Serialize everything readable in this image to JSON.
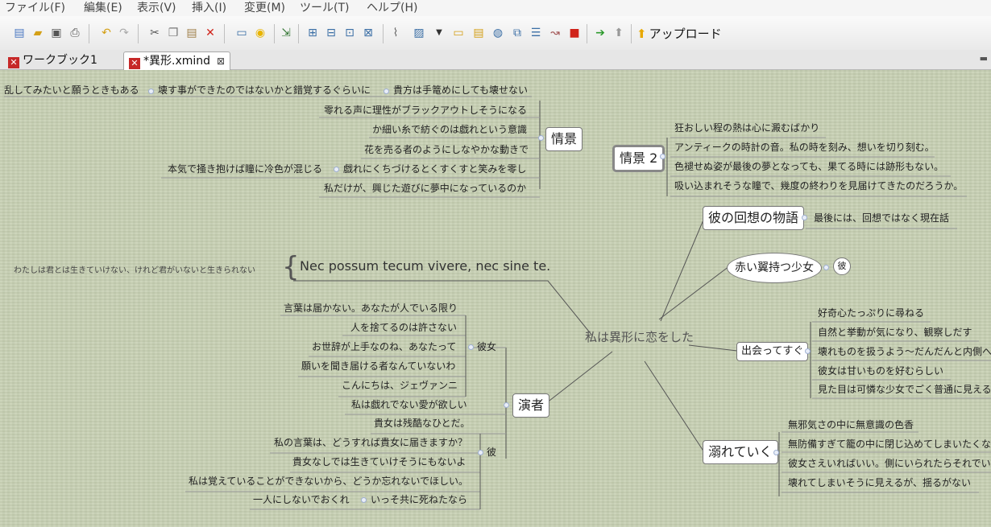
{
  "menu": [
    "ファイル(F)",
    "編集(E)",
    "表示(V)",
    "挿入(I)",
    "変更(M)",
    "ツール(T)",
    "ヘルプ(H)"
  ],
  "toolbar": {
    "upload_label": "アップロード"
  },
  "tabs": [
    {
      "label": "ワークブック1"
    },
    {
      "label": "*異形.xmind"
    }
  ],
  "mindmap": {
    "central": "私は異形に恋をした",
    "left_top_row": {
      "a": "乱してみたいと願うときもある",
      "b": "壊す事ができたのではないかと錯覚するぐらいに",
      "c": "貴方は手篭めにしても壊せない"
    },
    "scene": {
      "label": "情景",
      "items": [
        "零れる声に理性がブラックアウトしそうになる",
        "か細い糸で紡ぐのは戯れという意識",
        "花を売る者のようにしなやかな動きで",
        "戯れにくちづけるとくすくすと笑みを零し",
        "私だけが、興じた遊びに夢中になっているのか"
      ],
      "extra": "本気で掻き抱けば瞳に冷色が混じる"
    },
    "scene2": {
      "label": "情景 2",
      "items": [
        "狂おしい程の熱は心に澱むばかり",
        "アンティークの時計の音。私の時を刻み、想いを切り刻む。",
        "色褪せぬ姿が最後の夢となっても、果てる時には跡形もない。",
        "吸い込まれそうな瞳で、幾度の終わりを見届けてきたのだろうか。"
      ]
    },
    "latin": {
      "label": "Nec possum tecum vivere, nec sine te.",
      "note": "わたしは君とは生きていけない、けれど君がいないと生きられない"
    },
    "story": {
      "label": "彼の回想の物語",
      "items": [
        "最後には、回想ではなく現在話"
      ]
    },
    "girl": {
      "label": "赤い翼持つ少女",
      "child": "彼"
    },
    "meet": {
      "label": "出会ってすぐ",
      "items": [
        "好奇心たっぷりに尋ねる",
        "自然と挙動が気になり、観察しだす",
        "壊れものを扱うよう～だんだんと内側へ",
        "彼女は甘いものを好むらしい",
        "見た目は可憐な少女でごく普通に見える"
      ]
    },
    "drown": {
      "label": "溺れていく",
      "items": [
        "無邪気さの中に無意識の色香",
        "無防備すぎて籠の中に閉じ込めてしまいたくなる",
        "彼女さえいればいい。側にいられたらそれでいい",
        "壊れてしまいそうに見えるが、揺るがない"
      ]
    },
    "actor": {
      "label": "演者",
      "she": {
        "label": "彼女",
        "items": [
          "言葉は届かない。あなたが人でいる限り",
          "人を捨てるのは許さない",
          "お世辞が上手なのね、あなたって",
          "願いを聞き届ける者なんていないわ",
          "こんにちは、ジェヴァンニ"
        ]
      },
      "he": {
        "label": "彼",
        "items": [
          "私は戯れでない愛が欲しい",
          "貴女は残酷なひとだ。",
          "私の言葉は、どうすれば貴女に届きますか？",
          "貴女なしでは生きていけそうにもないよ",
          "私は覚えていることができないから、どうか忘れないでほしい。",
          "一人にしないでおくれ"
        ],
        "extra": "いっそ共に死ねたなら"
      }
    }
  }
}
